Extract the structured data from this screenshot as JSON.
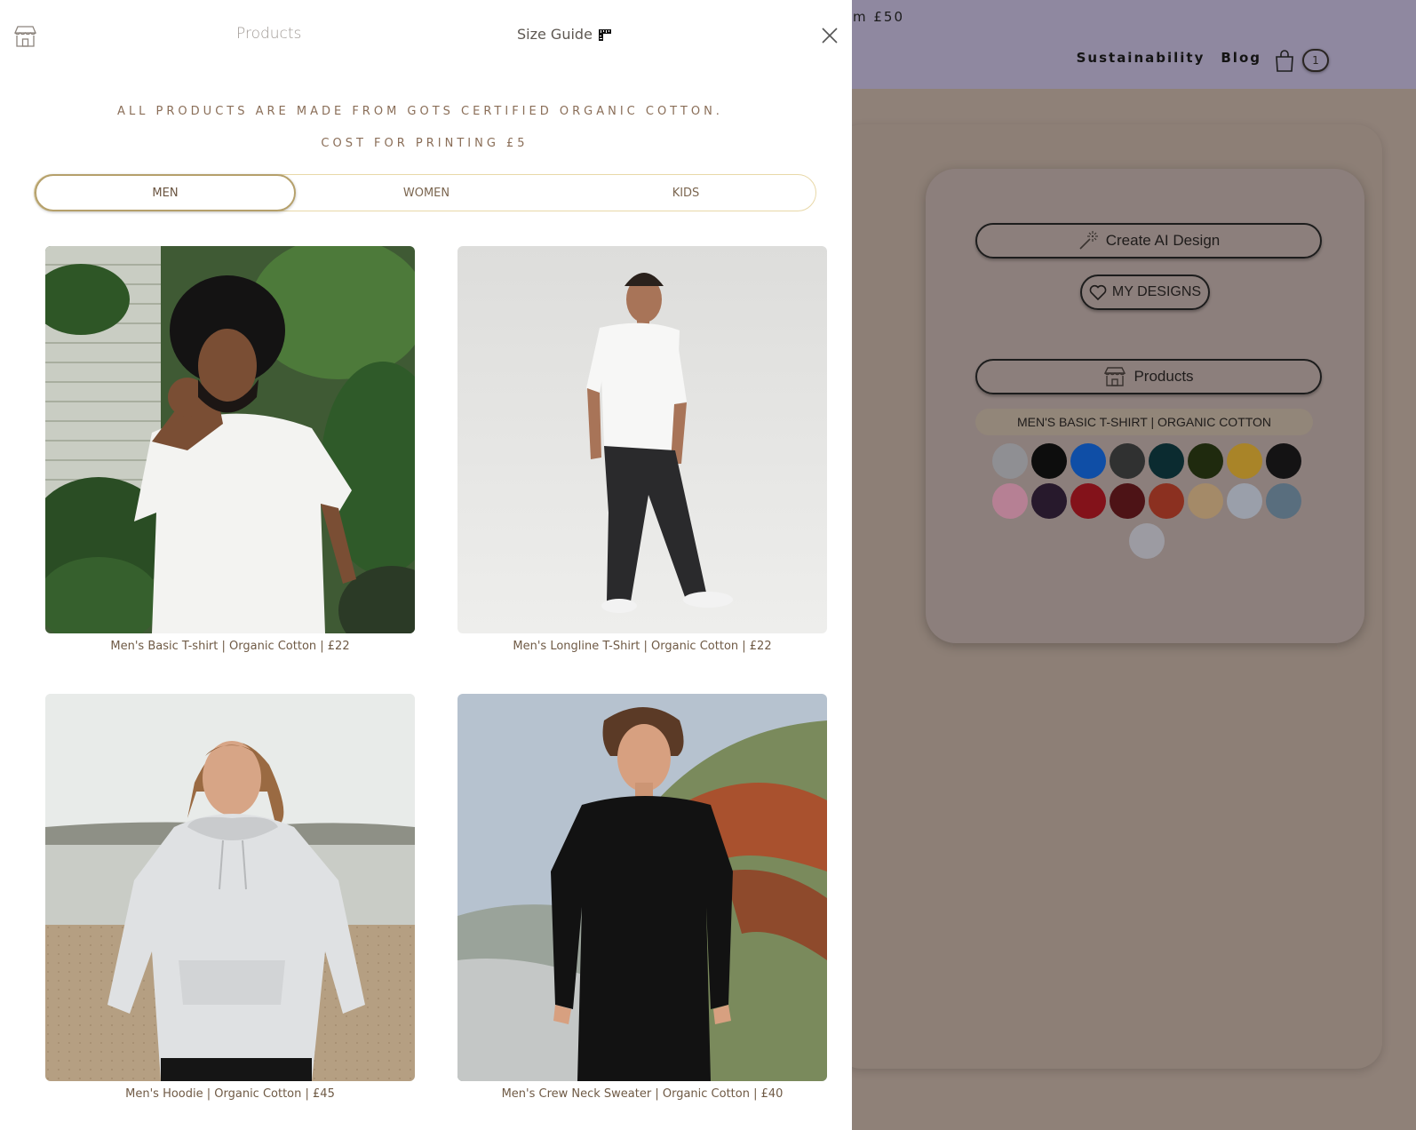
{
  "background": {
    "promo_text": "m £50",
    "nav": [
      {
        "label": "Sustainability"
      },
      {
        "label": "Blog"
      }
    ],
    "cart_count": "1",
    "ai_design_label": "Create AI Design",
    "my_designs_label": "MY DESIGNS",
    "products_label": "Products",
    "selected_product": "MEN'S BASIC T-SHIRT | ORGANIC COTTON",
    "swatch_colors": [
      "#8f8f93",
      "#0d0d0d",
      "#0f4ea6",
      "#303131",
      "#0b2b30",
      "#1f2a0e",
      "#a98428",
      "#141314",
      "#b68094",
      "#27192c",
      "#83121a",
      "#4d1316",
      "#8b3020",
      "#a48a68",
      "#9a9faa",
      "#596e7e",
      "#9c9ba2"
    ]
  },
  "panel": {
    "title": "Products",
    "size_guide_label": "Size Guide",
    "notice_line1": "ALL PRODUCTS ARE MADE FROM GOTS CERTIFIED ORGANIC COTTON.",
    "notice_line2": "COST FOR PRINTING £5",
    "tabs": [
      {
        "label": "MEN",
        "active": true
      },
      {
        "label": "WOMEN",
        "active": false
      },
      {
        "label": "KIDS",
        "active": false
      }
    ],
    "products": [
      {
        "caption": "Men's Basic T-shirt | Organic Cotton | £22"
      },
      {
        "caption": "Men's Longline T-Shirt | Organic Cotton | £22"
      },
      {
        "caption": "Men's Hoodie | Organic Cotton | £45"
      },
      {
        "caption": "Men's Crew Neck Sweater | Organic Cotton | £40"
      }
    ]
  },
  "colors": {
    "accent_gold": "#b5a06b",
    "text_brown": "#8a6e58"
  }
}
